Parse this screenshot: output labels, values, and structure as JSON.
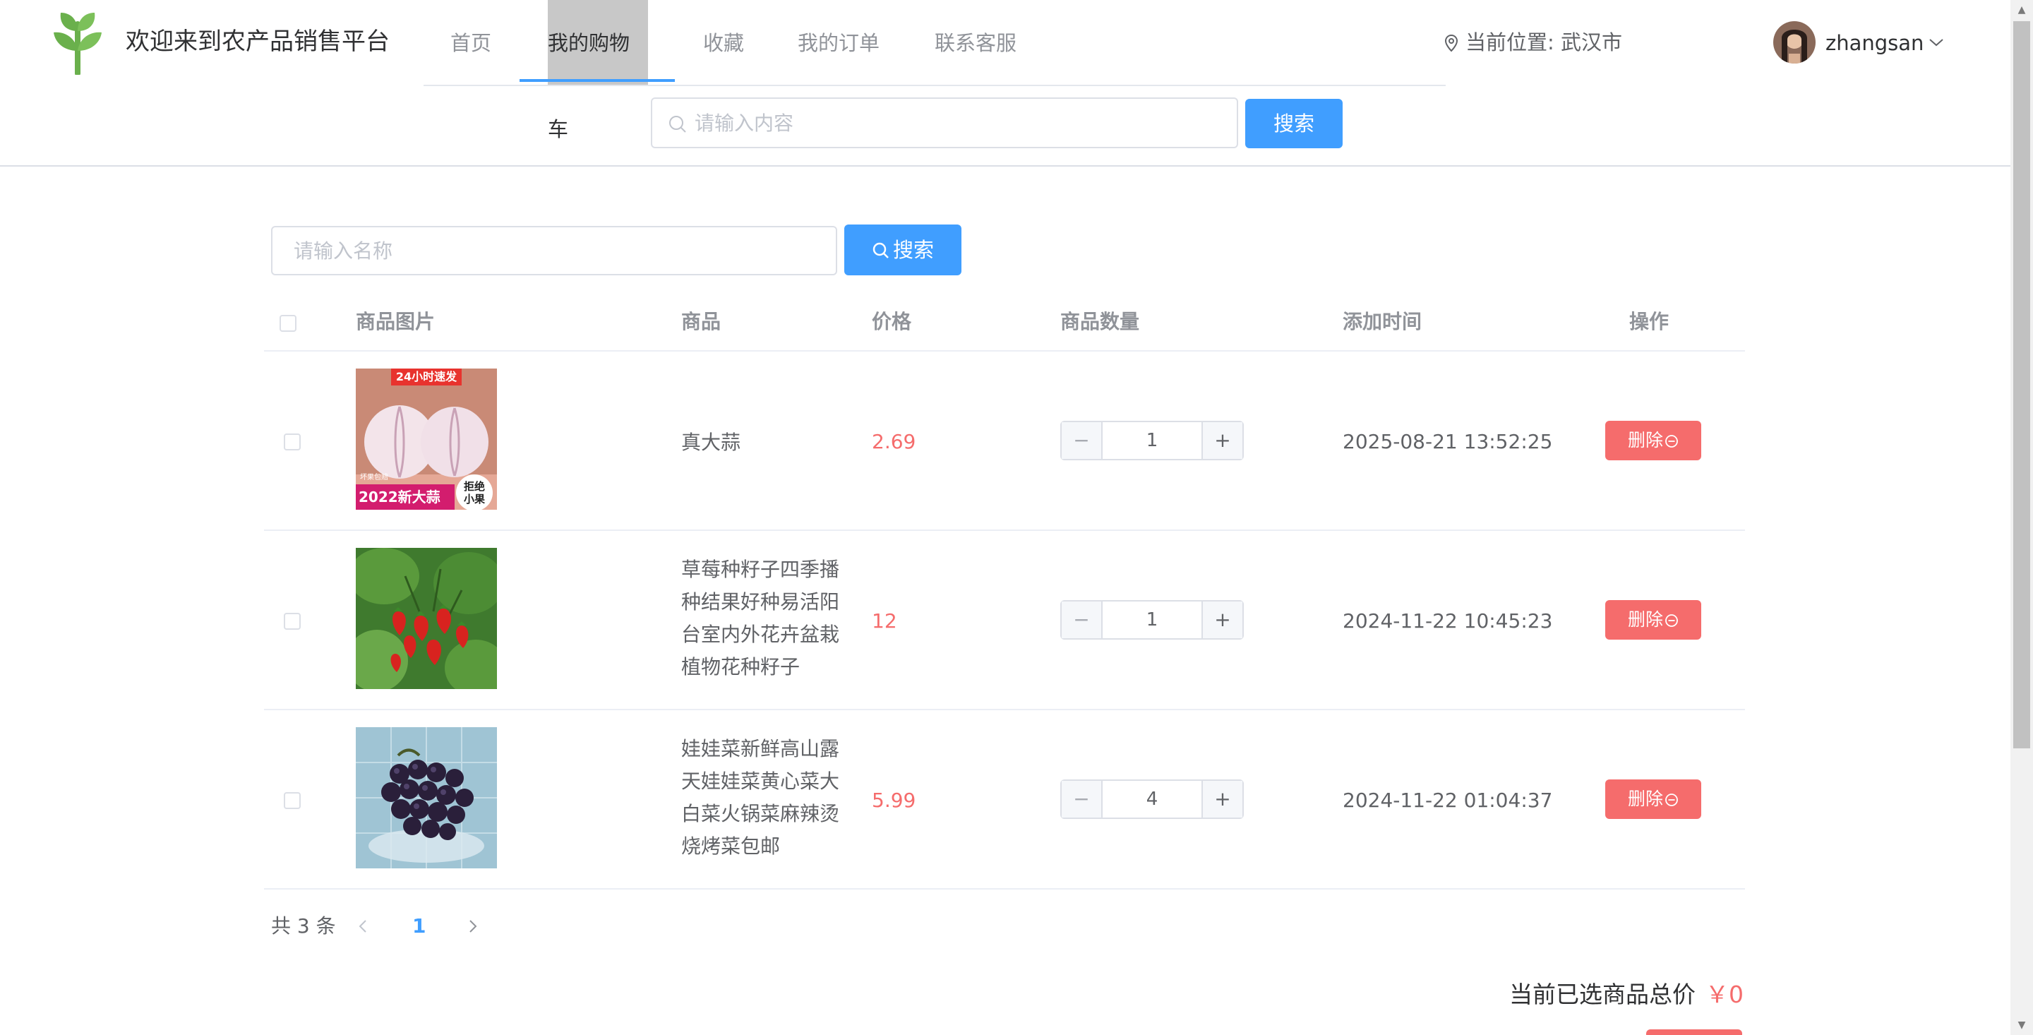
{
  "header": {
    "site_title": "欢迎来到农产品销售平台",
    "nav": [
      {
        "label": "首页"
      },
      {
        "label": "我的购物车"
      },
      {
        "label": "收藏"
      },
      {
        "label": "我的订单"
      },
      {
        "label": "联系客服"
      }
    ],
    "active_nav": "我的购物车",
    "location": "当前位置: 武汉市",
    "username": "zhangsan",
    "search": {
      "placeholder": "请输入内容",
      "button": "搜索"
    }
  },
  "cart": {
    "search": {
      "placeholder": "请输入名称",
      "button": "搜索"
    },
    "columns": [
      "商品图片",
      "商品",
      "价格",
      "商品数量",
      "添加时间",
      "操作"
    ],
    "rows": [
      {
        "name": "真大蒜",
        "price": "2.69",
        "quantity": "1",
        "time": "2025-08-21 13:52:25",
        "delete_label": "删除",
        "image": {
          "type": "garlic",
          "badge_top": "24小时速发",
          "badge_bottom": "2022新大蒜",
          "badge_round": "拒绝小果",
          "small_tag": "坏果包赔"
        }
      },
      {
        "name": "草莓种籽子四季播种结果好种易活阳台室内外花卉盆栽植物花种籽子",
        "price": "12",
        "quantity": "1",
        "time": "2024-11-22 10:45:23",
        "delete_label": "删除",
        "image": {
          "type": "strawberry"
        }
      },
      {
        "name": "娃娃菜新鲜高山露天娃娃菜黄心菜大白菜火锅菜麻辣烫烧烤菜包邮",
        "price": "5.99",
        "quantity": "4",
        "time": "2024-11-22 01:04:37",
        "delete_label": "删除",
        "image": {
          "type": "grapes"
        }
      }
    ],
    "pager": {
      "total": "共 3 条",
      "current": "1"
    },
    "summary": {
      "label": "当前已选商品总价",
      "amount": "￥0"
    }
  },
  "colors": {
    "primary": "#409eff",
    "danger": "#f56c6c",
    "brand_green": "#6ab04c"
  }
}
